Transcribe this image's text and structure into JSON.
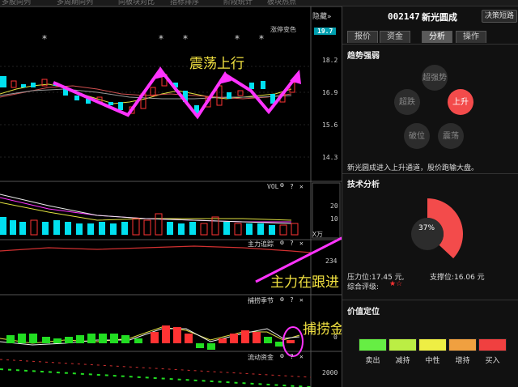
{
  "top_menu": [
    "多股同列",
    "多周期同列",
    "同板块对比",
    "指标排序",
    "阶段统计",
    "板块热点"
  ],
  "chart": {
    "hide_label": "隐藏",
    "hide_arrows": "»",
    "main_indicator": "涨停变色",
    "current_price_box": "19.7",
    "price_labels": [
      "18.2",
      "16.9",
      "15.6",
      "14.3"
    ],
    "vol_label": "VOL",
    "vol_labels": [
      "20",
      "10"
    ],
    "vol_unit": "X万",
    "zhuli_label": "主力追踪",
    "zhuli_value": "234",
    "buhuo_label": "捕捞季节",
    "buhuo_value": "0",
    "flow_label": "流动资金",
    "flow_value": "2000",
    "icon_glyphs": {
      "gear": "⚙",
      "question": "?",
      "close": "✕"
    },
    "star_marks": [
      "*",
      "*",
      "*",
      "*",
      "*"
    ],
    "annotations": {
      "trend": "震荡上行",
      "main_force": "主力在跟进",
      "golden_cross": "捕捞金叉"
    }
  },
  "stock": {
    "code": "002147",
    "name": "新光圆成",
    "decision_button": "决策短路"
  },
  "tabs": [
    {
      "label": "报价",
      "active": false
    },
    {
      "label": "资金",
      "active": false
    },
    {
      "label": "分析",
      "active": true
    },
    {
      "label": "操作",
      "active": false
    }
  ],
  "trend_strength": {
    "title": "趋势强弱",
    "options": [
      {
        "label": "超强势",
        "active": false
      },
      {
        "label": "超跌",
        "active": false
      },
      {
        "label": "上升",
        "active": true
      },
      {
        "label": "破位",
        "active": false
      },
      {
        "label": "震荡",
        "active": false
      }
    ],
    "summary": "新光圆成进入上升通道，股价跑输大盘。"
  },
  "technical": {
    "title": "技术分析",
    "percent": "37%",
    "percent_value": 0.37,
    "pressure": "压力位:17.45 元,",
    "support": "支撑位:16.06 元",
    "rating_label": "综合评级:",
    "rating_stars": "★☆"
  },
  "value_position": {
    "title": "价值定位",
    "segments": [
      {
        "label": "卖出",
        "color": "#66ee44"
      },
      {
        "label": "减持",
        "color": "#bbee44"
      },
      {
        "label": "中性",
        "color": "#eeee44"
      },
      {
        "label": "增持",
        "color": "#f0a040"
      },
      {
        "label": "买入",
        "color": "#f04040"
      }
    ]
  },
  "colors": {
    "up": "#ff3333",
    "down": "#00e0f0",
    "accent": "#ff33ff",
    "annotation": "#f0e040"
  }
}
